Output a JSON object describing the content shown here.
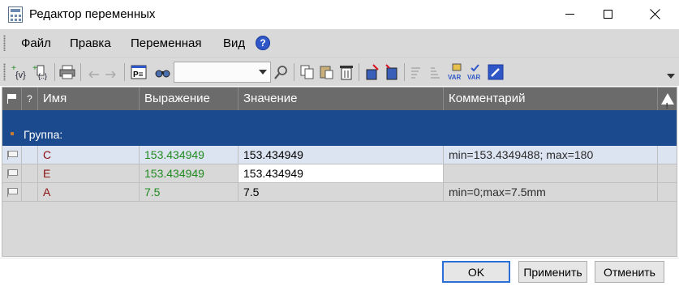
{
  "window": {
    "title": "Редактор переменных"
  },
  "menu": {
    "items": [
      "Файл",
      "Правка",
      "Переменная",
      "Вид"
    ]
  },
  "toolbar": {
    "search": {
      "value": ""
    },
    "icons": [
      "add-variable-icon",
      "add-function-variable-icon",
      "print-icon",
      "undo-icon",
      "redo-icon",
      "properties-icon",
      "find-icon",
      "search-icon",
      "copy-icon",
      "paste-icon",
      "delete-icon",
      "insert-before-icon",
      "insert-after-icon",
      "sort-icon",
      "sort-desc-icon",
      "var-icon",
      "var-check-icon",
      "edit-icon"
    ]
  },
  "table": {
    "columns": [
      "Имя",
      "Выражение",
      "Значение",
      "Комментарий"
    ],
    "group": {
      "label": "Группа:"
    },
    "rows": [
      {
        "name": "C",
        "expression": "153.434949",
        "value": "153.434949",
        "comment": "min=153.4349488; max=180"
      },
      {
        "name": "E",
        "expression": "153.434949",
        "value": "153.434949",
        "comment": ""
      },
      {
        "name": "A",
        "expression": "7.5",
        "value": "7.5",
        "comment": "min=0;max=7.5mm"
      }
    ]
  },
  "footer": {
    "ok": "OK",
    "apply": "Применить",
    "cancel": "Отменить"
  },
  "colors": {
    "group_bg": "#1b4a8e",
    "header_bg": "#6b6b6b",
    "name": "#8b1010",
    "expression": "#1f8b1f"
  }
}
